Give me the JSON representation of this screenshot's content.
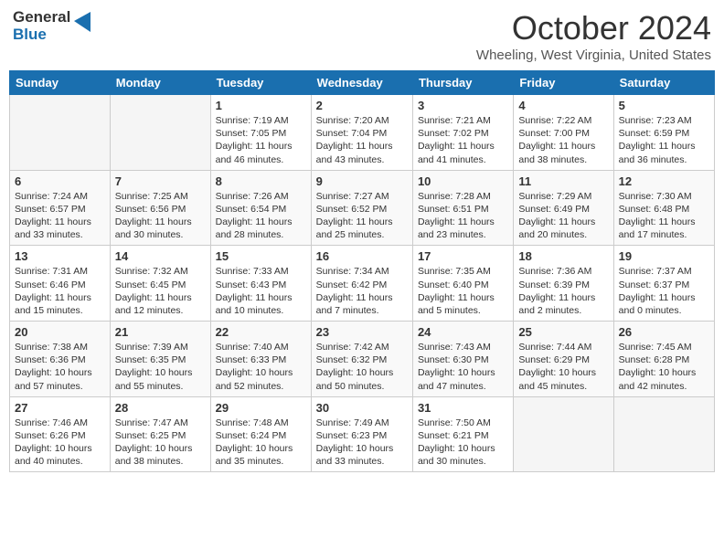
{
  "header": {
    "logo_general": "General",
    "logo_blue": "Blue",
    "title": "October 2024",
    "location": "Wheeling, West Virginia, United States"
  },
  "days_of_week": [
    "Sunday",
    "Monday",
    "Tuesday",
    "Wednesday",
    "Thursday",
    "Friday",
    "Saturday"
  ],
  "weeks": [
    [
      {
        "day": "",
        "empty": true
      },
      {
        "day": "",
        "empty": true
      },
      {
        "day": "1",
        "sunrise": "Sunrise: 7:19 AM",
        "sunset": "Sunset: 7:05 PM",
        "daylight": "Daylight: 11 hours and 46 minutes."
      },
      {
        "day": "2",
        "sunrise": "Sunrise: 7:20 AM",
        "sunset": "Sunset: 7:04 PM",
        "daylight": "Daylight: 11 hours and 43 minutes."
      },
      {
        "day": "3",
        "sunrise": "Sunrise: 7:21 AM",
        "sunset": "Sunset: 7:02 PM",
        "daylight": "Daylight: 11 hours and 41 minutes."
      },
      {
        "day": "4",
        "sunrise": "Sunrise: 7:22 AM",
        "sunset": "Sunset: 7:00 PM",
        "daylight": "Daylight: 11 hours and 38 minutes."
      },
      {
        "day": "5",
        "sunrise": "Sunrise: 7:23 AM",
        "sunset": "Sunset: 6:59 PM",
        "daylight": "Daylight: 11 hours and 36 minutes."
      }
    ],
    [
      {
        "day": "6",
        "sunrise": "Sunrise: 7:24 AM",
        "sunset": "Sunset: 6:57 PM",
        "daylight": "Daylight: 11 hours and 33 minutes."
      },
      {
        "day": "7",
        "sunrise": "Sunrise: 7:25 AM",
        "sunset": "Sunset: 6:56 PM",
        "daylight": "Daylight: 11 hours and 30 minutes."
      },
      {
        "day": "8",
        "sunrise": "Sunrise: 7:26 AM",
        "sunset": "Sunset: 6:54 PM",
        "daylight": "Daylight: 11 hours and 28 minutes."
      },
      {
        "day": "9",
        "sunrise": "Sunrise: 7:27 AM",
        "sunset": "Sunset: 6:52 PM",
        "daylight": "Daylight: 11 hours and 25 minutes."
      },
      {
        "day": "10",
        "sunrise": "Sunrise: 7:28 AM",
        "sunset": "Sunset: 6:51 PM",
        "daylight": "Daylight: 11 hours and 23 minutes."
      },
      {
        "day": "11",
        "sunrise": "Sunrise: 7:29 AM",
        "sunset": "Sunset: 6:49 PM",
        "daylight": "Daylight: 11 hours and 20 minutes."
      },
      {
        "day": "12",
        "sunrise": "Sunrise: 7:30 AM",
        "sunset": "Sunset: 6:48 PM",
        "daylight": "Daylight: 11 hours and 17 minutes."
      }
    ],
    [
      {
        "day": "13",
        "sunrise": "Sunrise: 7:31 AM",
        "sunset": "Sunset: 6:46 PM",
        "daylight": "Daylight: 11 hours and 15 minutes."
      },
      {
        "day": "14",
        "sunrise": "Sunrise: 7:32 AM",
        "sunset": "Sunset: 6:45 PM",
        "daylight": "Daylight: 11 hours and 12 minutes."
      },
      {
        "day": "15",
        "sunrise": "Sunrise: 7:33 AM",
        "sunset": "Sunset: 6:43 PM",
        "daylight": "Daylight: 11 hours and 10 minutes."
      },
      {
        "day": "16",
        "sunrise": "Sunrise: 7:34 AM",
        "sunset": "Sunset: 6:42 PM",
        "daylight": "Daylight: 11 hours and 7 minutes."
      },
      {
        "day": "17",
        "sunrise": "Sunrise: 7:35 AM",
        "sunset": "Sunset: 6:40 PM",
        "daylight": "Daylight: 11 hours and 5 minutes."
      },
      {
        "day": "18",
        "sunrise": "Sunrise: 7:36 AM",
        "sunset": "Sunset: 6:39 PM",
        "daylight": "Daylight: 11 hours and 2 minutes."
      },
      {
        "day": "19",
        "sunrise": "Sunrise: 7:37 AM",
        "sunset": "Sunset: 6:37 PM",
        "daylight": "Daylight: 11 hours and 0 minutes."
      }
    ],
    [
      {
        "day": "20",
        "sunrise": "Sunrise: 7:38 AM",
        "sunset": "Sunset: 6:36 PM",
        "daylight": "Daylight: 10 hours and 57 minutes."
      },
      {
        "day": "21",
        "sunrise": "Sunrise: 7:39 AM",
        "sunset": "Sunset: 6:35 PM",
        "daylight": "Daylight: 10 hours and 55 minutes."
      },
      {
        "day": "22",
        "sunrise": "Sunrise: 7:40 AM",
        "sunset": "Sunset: 6:33 PM",
        "daylight": "Daylight: 10 hours and 52 minutes."
      },
      {
        "day": "23",
        "sunrise": "Sunrise: 7:42 AM",
        "sunset": "Sunset: 6:32 PM",
        "daylight": "Daylight: 10 hours and 50 minutes."
      },
      {
        "day": "24",
        "sunrise": "Sunrise: 7:43 AM",
        "sunset": "Sunset: 6:30 PM",
        "daylight": "Daylight: 10 hours and 47 minutes."
      },
      {
        "day": "25",
        "sunrise": "Sunrise: 7:44 AM",
        "sunset": "Sunset: 6:29 PM",
        "daylight": "Daylight: 10 hours and 45 minutes."
      },
      {
        "day": "26",
        "sunrise": "Sunrise: 7:45 AM",
        "sunset": "Sunset: 6:28 PM",
        "daylight": "Daylight: 10 hours and 42 minutes."
      }
    ],
    [
      {
        "day": "27",
        "sunrise": "Sunrise: 7:46 AM",
        "sunset": "Sunset: 6:26 PM",
        "daylight": "Daylight: 10 hours and 40 minutes."
      },
      {
        "day": "28",
        "sunrise": "Sunrise: 7:47 AM",
        "sunset": "Sunset: 6:25 PM",
        "daylight": "Daylight: 10 hours and 38 minutes."
      },
      {
        "day": "29",
        "sunrise": "Sunrise: 7:48 AM",
        "sunset": "Sunset: 6:24 PM",
        "daylight": "Daylight: 10 hours and 35 minutes."
      },
      {
        "day": "30",
        "sunrise": "Sunrise: 7:49 AM",
        "sunset": "Sunset: 6:23 PM",
        "daylight": "Daylight: 10 hours and 33 minutes."
      },
      {
        "day": "31",
        "sunrise": "Sunrise: 7:50 AM",
        "sunset": "Sunset: 6:21 PM",
        "daylight": "Daylight: 10 hours and 30 minutes."
      },
      {
        "day": "",
        "empty": true
      },
      {
        "day": "",
        "empty": true
      }
    ]
  ]
}
